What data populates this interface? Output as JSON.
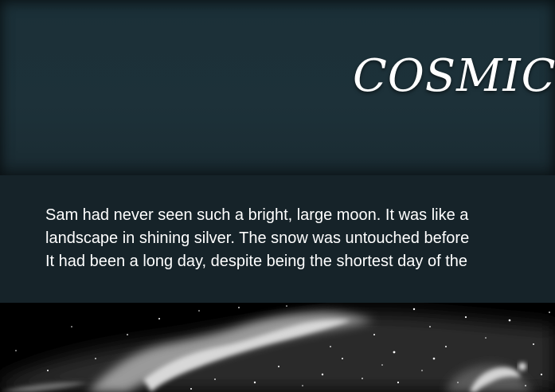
{
  "header": {
    "title": "COSMIC"
  },
  "intro": {
    "lines": [
      "Sam had never seen such a bright, large moon. It was like a",
      "landscape in shining silver. The snow was untouched before",
      "It had been a long day, despite being the shortest day of the"
    ]
  },
  "hero": {
    "image": "night-sky-nebula"
  }
}
